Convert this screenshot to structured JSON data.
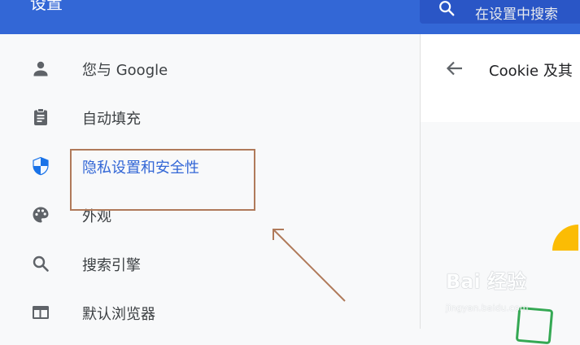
{
  "header": {
    "title": "设置",
    "search_placeholder": "在设置中搜索"
  },
  "sidebar": {
    "items": [
      {
        "label": "您与 Google",
        "icon": "person-icon"
      },
      {
        "label": "自动填充",
        "icon": "clipboard-icon"
      },
      {
        "label": "隐私设置和安全性",
        "icon": "shield-icon",
        "active": true
      },
      {
        "label": "外观",
        "icon": "palette-icon"
      },
      {
        "label": "搜索引擎",
        "icon": "search-icon"
      },
      {
        "label": "默认浏览器",
        "icon": "browser-icon"
      }
    ]
  },
  "content": {
    "title": "Cookie 及其"
  },
  "watermark": {
    "text": "Bai 经验",
    "sub": "jingyan.baidu.com"
  },
  "colors": {
    "header_bg": "#3367d6",
    "active_text": "#3367d6",
    "annotation": "#b07a5a"
  }
}
